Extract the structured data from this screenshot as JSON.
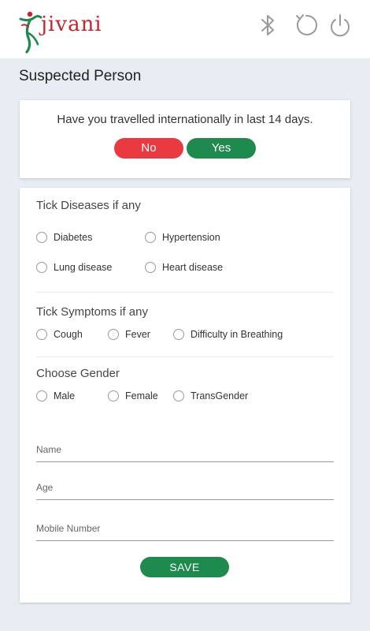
{
  "app": {
    "logo_text": "jivani",
    "brand_red": "#c6242b",
    "brand_green": "#1e8a4e"
  },
  "header": {
    "icons": [
      "bluetooth-icon",
      "refresh-icon",
      "power-icon"
    ]
  },
  "page": {
    "title": "Suspected Person"
  },
  "travel": {
    "question": "Have you travelled internationally in last 14 days.",
    "no_label": "No",
    "yes_label": "Yes",
    "no_color": "#e83a3f",
    "yes_color": "#1e8a4e"
  },
  "diseases": {
    "title": "Tick Diseases if any",
    "options": [
      "Diabetes",
      "Hypertension",
      "Lung disease",
      "Heart disease"
    ]
  },
  "symptoms": {
    "title": "Tick Symptoms if any",
    "options": [
      "Cough",
      "Fever",
      "Difficulty in Breathing"
    ]
  },
  "gender": {
    "title": "Choose Gender",
    "options": [
      "Male",
      "Female",
      "TransGender"
    ]
  },
  "fields": {
    "name_placeholder": "Name",
    "age_placeholder": "Age",
    "mobile_placeholder": "Mobile Number"
  },
  "save_label": "SAVE"
}
